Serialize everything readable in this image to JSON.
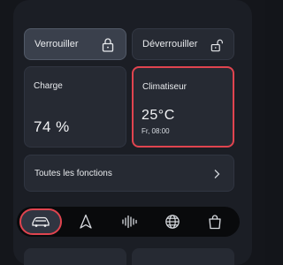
{
  "colors": {
    "background": "#14161b",
    "panel": "#1b1e25",
    "tile": "#262a33",
    "tile_active": "#3a404c",
    "highlight": "#e0444f",
    "tab_bar": "#090a0c",
    "text": "#e9ebee"
  },
  "lock": {
    "label": "Verrouiller",
    "icon": "lock-icon",
    "active": true
  },
  "unlock": {
    "label": "Déverrouiller",
    "icon": "unlock-icon"
  },
  "charge": {
    "title": "Charge",
    "value": "74 %"
  },
  "climate": {
    "title": "Climatiseur",
    "temperature": "25°C",
    "schedule": "Fr, 08:00"
  },
  "functions": {
    "label": "Toutes les fonctions",
    "icon": "chevron-right-icon"
  },
  "tabs": [
    {
      "name": "car",
      "icon": "car-icon",
      "selected": true
    },
    {
      "name": "navigation",
      "icon": "navigation-arrow-icon",
      "selected": false
    },
    {
      "name": "audio",
      "icon": "audio-waveform-icon",
      "selected": false
    },
    {
      "name": "web",
      "icon": "globe-icon",
      "selected": false
    },
    {
      "name": "shop",
      "icon": "shopping-bag-icon",
      "selected": false
    }
  ]
}
